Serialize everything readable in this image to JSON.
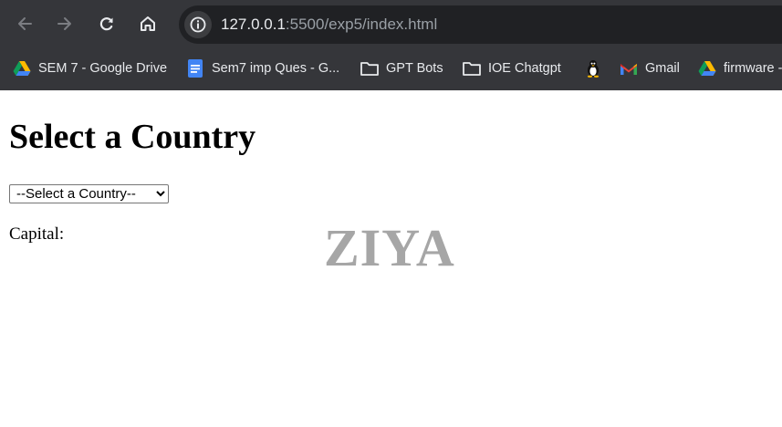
{
  "browser": {
    "url_host": "127.0.0.1",
    "url_path": ":5500/exp5/index.html",
    "nav": {
      "back_icon": "arrow-left-icon",
      "forward_icon": "arrow-right-icon",
      "reload_icon": "reload-icon",
      "home_icon": "home-icon",
      "site_info_icon": "info-icon"
    },
    "bookmarks": [
      {
        "label": "SEM 7 - Google Drive",
        "icon": "google-drive-icon"
      },
      {
        "label": "Sem7 imp Ques - G...",
        "icon": "google-docs-icon"
      },
      {
        "label": "GPT Bots",
        "icon": "folder-icon"
      },
      {
        "label": "IOE Chatgpt",
        "icon": "folder-icon"
      },
      {
        "label": "",
        "icon": "tux-penguin-icon"
      },
      {
        "label": "Gmail",
        "icon": "gmail-icon"
      },
      {
        "label": "firmware -",
        "icon": "google-drive-icon"
      }
    ],
    "colors": {
      "chrome": "#35363a",
      "omnibox": "#202124",
      "text": "#e8eaed",
      "muted": "#9aa0a6"
    }
  },
  "page": {
    "title": "Select a Country",
    "select": {
      "selected": "--Select a Country--"
    },
    "capital_label": "Capital:",
    "watermark": "ZIYA"
  }
}
